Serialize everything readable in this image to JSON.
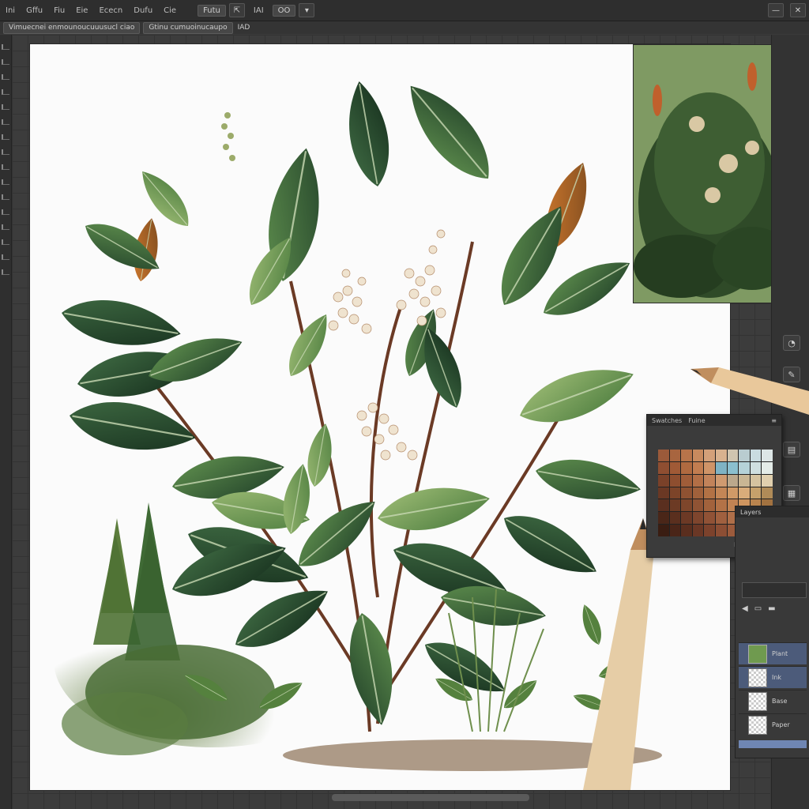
{
  "menubar": {
    "items": [
      "Ini",
      "Gffu",
      "Fiu",
      "Eie",
      "Ececn",
      "Dufu",
      "Cie"
    ],
    "tool_field": "Futu",
    "tool_ai": "IAI",
    "tool_box": "OO"
  },
  "options_bar": {
    "tab1": "Vimuecnei enmounoucuuusucl ciao",
    "tab2": "Gtinu cumuoinucaupo",
    "tab2_suffix": "IAD"
  },
  "swatches_panel": {
    "title": "Swatches",
    "subtitle": "Fuine",
    "colors": [
      "#9b5a3a",
      "#a8653f",
      "#b7744a",
      "#c88a5e",
      "#d3a079",
      "#d8b28f",
      "#cfc5b0",
      "#b9ccd0",
      "#c9dbe0",
      "#dde6e6",
      "#8f4e31",
      "#a05a36",
      "#b06a40",
      "#c27d50",
      "#cf9468",
      "#7fb3c4",
      "#8bc0cf",
      "#b5d2d8",
      "#cfdfe0",
      "#e4ece8",
      "#7a4129",
      "#8e4e2f",
      "#a05d39",
      "#b36f46",
      "#c2835a",
      "#cf9a70",
      "#bba88c",
      "#c9b694",
      "#d5c3a0",
      "#e0cfae",
      "#6a3824",
      "#7c4429",
      "#8f5232",
      "#a0613b",
      "#b27245",
      "#c38656",
      "#d09a67",
      "#d9ac7a",
      "#c6a16b",
      "#b08b58",
      "#5a2f1f",
      "#6c3a24",
      "#7e462b",
      "#905334",
      "#a2623c",
      "#b37247",
      "#c28353",
      "#cf955f",
      "#b9844e",
      "#a27240",
      "#4a2618",
      "#5a2f1e",
      "#6c3925",
      "#7e452d",
      "#905236",
      "#a0603f",
      "#b06f49",
      "#bd7f53",
      "#a8703f",
      "#8e5c33",
      "#3a1d12",
      "#4a2518",
      "#5a2e1e",
      "#6a3725",
      "#7c422c",
      "#8c4e34",
      "#9c5b3c",
      "#a96744",
      "#935837",
      "#7a482c"
    ]
  },
  "layers_panel": {
    "header": "Layers",
    "rows": [
      "Plant",
      "Ink",
      "Base",
      "Paper"
    ]
  }
}
